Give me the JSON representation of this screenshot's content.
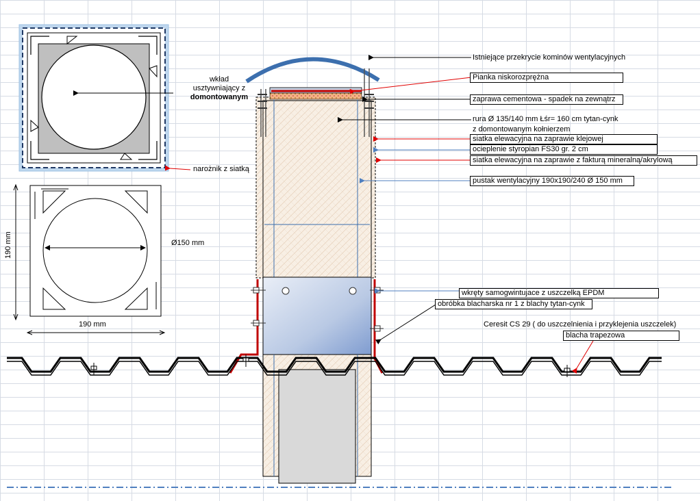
{
  "labels": {
    "wklad_line1": "wkład",
    "wklad_line2": "usztywniający z",
    "wklad_line3": "domontowanym",
    "naroznik": "narożnik z siatką",
    "dimension_vertical": "190 mm",
    "dimension_horizontal": "190 mm",
    "diameter": "Ø150 mm",
    "przekrycie": "Istniejące przekrycie kominów wentylacyjnych",
    "pianka": "Pianka niskorozprężna",
    "zaprawa": "zaprawa cementowa - spadek na zewnątrz",
    "rura_line1": "rura Ø 135/140 mm Łśr= 160 cm tytan-cynk",
    "rura_line2": "z  domontowanym kołnierzem",
    "siatka_klejowa": "siatka elewacyjna  na zaprawie klejowej",
    "ocieplenie": "ocieplenie styropian FS30 gr. 2 cm",
    "siatka_faktura": "siatka elewacyjna na zaprawie z fakturą mineralną/akrylową",
    "pustak": "pustak wentylacyjny  190x190/240 Ø 150 mm",
    "wkrety": "wkręty samogwintujace z uszczelką EPDM",
    "obrobka": "obróbka blacharska  nr 1 z blachy tytan-cynk",
    "ceresit": "Ceresit CS 29 ( do uszczelnienia i przyklejenia uszczelek)",
    "blacha": "blacha trapezowa"
  },
  "colors": {
    "grid": "#d6dbe4",
    "cap": "#3c6fae",
    "flashing": "#c00000",
    "insulation_fill": "#f7ecdf",
    "pipe_fill": "#d9d9d9",
    "leader_red": "#e00000",
    "leader_blue": "#4f7fbf"
  }
}
